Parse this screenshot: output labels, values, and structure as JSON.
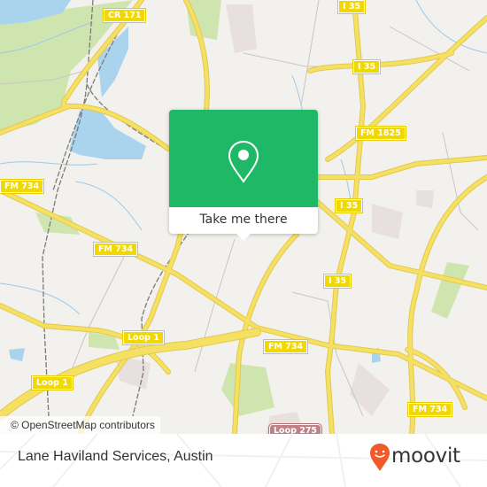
{
  "map": {
    "attribution": "© OpenStreetMap contributors",
    "colors": {
      "background": "#f2f1ee",
      "water": "#aad3ee",
      "park": "#cfe5b0",
      "road": "#f6e063",
      "road_casing": "#e2c94a",
      "urban": "#e8e0de",
      "accent": "#1fb866"
    },
    "road_labels": [
      {
        "id": "cr171",
        "text": "CR 171"
      },
      {
        "id": "i35_a",
        "text": "I 35"
      },
      {
        "id": "i35_b",
        "text": "I 35"
      },
      {
        "id": "fm1825",
        "text": "FM 1825"
      },
      {
        "id": "fm734_a",
        "text": "FM 734"
      },
      {
        "id": "fm734_b",
        "text": "FM 734"
      },
      {
        "id": "i35_c",
        "text": "I 35"
      },
      {
        "id": "i35_d",
        "text": "I 35"
      },
      {
        "id": "fm734_c",
        "text": "FM 734"
      },
      {
        "id": "loop1_a",
        "text": "Loop 1"
      },
      {
        "id": "loop1_b",
        "text": "Loop 1"
      },
      {
        "id": "fm734_d",
        "text": "FM 734"
      },
      {
        "id": "loop275",
        "text": "Loop 275"
      }
    ]
  },
  "popup": {
    "icon": "map-pin-icon",
    "button_label": "Take me there"
  },
  "footer": {
    "place_name": "Lane Haviland Services, Austin",
    "brand": "moovit",
    "brand_icon": "moovit-smiley-pin-icon",
    "brand_color": "#f15a29"
  }
}
